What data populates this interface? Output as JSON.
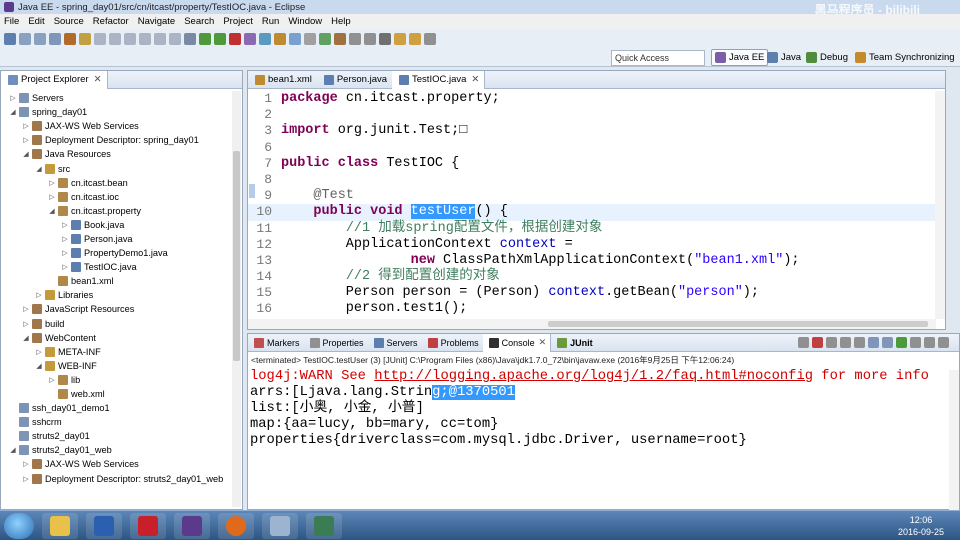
{
  "window": {
    "title": "Java EE - spring_day01/src/cn/itcast/property/TestIOC.java - Eclipse",
    "watermark": "黑马程序员 - bilibili"
  },
  "menu": [
    "File",
    "Edit",
    "Source",
    "Refactor",
    "Navigate",
    "Search",
    "Project",
    "Run",
    "Window",
    "Help"
  ],
  "toolbar": {
    "quick_access": "Quick Access",
    "perspectives": [
      "Java EE",
      "Java",
      "Debug",
      "Team Synchronizing"
    ]
  },
  "project_explorer": {
    "tab_label": "Project Explorer",
    "items": [
      {
        "label": "Servers",
        "depth": 0,
        "twisty": "▷"
      },
      {
        "label": "spring_day01",
        "depth": 0,
        "twisty": "◢"
      },
      {
        "label": "JAX-WS Web Services",
        "depth": 1,
        "twisty": "▷"
      },
      {
        "label": "Deployment Descriptor: spring_day01",
        "depth": 1,
        "twisty": "▷"
      },
      {
        "label": "Java Resources",
        "depth": 1,
        "twisty": "◢"
      },
      {
        "label": "src",
        "depth": 2,
        "twisty": "◢"
      },
      {
        "label": "cn.itcast.bean",
        "depth": 3,
        "twisty": "▷"
      },
      {
        "label": "cn.itcast.ioc",
        "depth": 3,
        "twisty": "▷"
      },
      {
        "label": "cn.itcast.property",
        "depth": 3,
        "twisty": "◢"
      },
      {
        "label": "Book.java",
        "depth": 4,
        "twisty": "▷"
      },
      {
        "label": "Person.java",
        "depth": 4,
        "twisty": "▷"
      },
      {
        "label": "PropertyDemo1.java",
        "depth": 4,
        "twisty": "▷"
      },
      {
        "label": "TestIOC.java",
        "depth": 4,
        "twisty": "▷"
      },
      {
        "label": "bean1.xml",
        "depth": 3,
        "twisty": ""
      },
      {
        "label": "Libraries",
        "depth": 2,
        "twisty": "▷"
      },
      {
        "label": "JavaScript Resources",
        "depth": 1,
        "twisty": "▷"
      },
      {
        "label": "build",
        "depth": 1,
        "twisty": "▷"
      },
      {
        "label": "WebContent",
        "depth": 1,
        "twisty": "◢"
      },
      {
        "label": "META-INF",
        "depth": 2,
        "twisty": "▷"
      },
      {
        "label": "WEB-INF",
        "depth": 2,
        "twisty": "◢"
      },
      {
        "label": "lib",
        "depth": 3,
        "twisty": "▷"
      },
      {
        "label": "web.xml",
        "depth": 3,
        "twisty": ""
      },
      {
        "label": "ssh_day01_demo1",
        "depth": 0,
        "twisty": ""
      },
      {
        "label": "sshcrm",
        "depth": 0,
        "twisty": ""
      },
      {
        "label": "struts2_day01",
        "depth": 0,
        "twisty": ""
      },
      {
        "label": "struts2_day01_web",
        "depth": 0,
        "twisty": "◢"
      },
      {
        "label": "JAX-WS Web Services",
        "depth": 1,
        "twisty": "▷"
      },
      {
        "label": "Deployment Descriptor: struts2_day01_web",
        "depth": 1,
        "twisty": "▷"
      }
    ]
  },
  "editor": {
    "tabs": [
      "bean1.xml",
      "Person.java",
      "TestIOC.java"
    ],
    "active_tab": "TestIOC.java",
    "lines": [
      {
        "n": "1",
        "html": "<span class=\"kw\">package</span> cn.itcast.property;"
      },
      {
        "n": "2",
        "html": ""
      },
      {
        "n": "3",
        "html": "<span class=\"kw\">import</span> org.junit.Test;&#9633;"
      },
      {
        "n": "6",
        "html": ""
      },
      {
        "n": "7",
        "html": "<span class=\"kw\">public class</span> TestIOC {"
      },
      {
        "n": "8",
        "html": ""
      },
      {
        "n": "9",
        "html": "    <span class=\"an\">@Test</span>"
      },
      {
        "n": "10",
        "html": "    <span class=\"kw\">public void</span> <span class=\"sel\">testUser</span>() {"
      },
      {
        "n": "11",
        "html": "        <span class=\"cm\">//1 加载spring配置文件，根据创建对象</span>"
      },
      {
        "n": "12",
        "html": "        ApplicationContext <span class=\"fv\">context</span> ="
      },
      {
        "n": "13",
        "html": "                <span class=\"kw\">new</span> ClassPathXmlApplicationContext(<span class=\"str\">\"bean1.xml\"</span>);"
      },
      {
        "n": "14",
        "html": "        <span class=\"cm\">//2 得到配置创建的对象</span>"
      },
      {
        "n": "15",
        "html": "        Person person = (Person) <span class=\"fv\">context</span>.getBean(<span class=\"str\">\"person\"</span>);"
      },
      {
        "n": "16",
        "html": "        person.test1();"
      }
    ]
  },
  "console": {
    "tabs": [
      "Markers",
      "Properties",
      "Servers",
      "Problems",
      "Console",
      "JUnit"
    ],
    "active_tab": "Console",
    "terminated": "<terminated> TestIOC.testUser (3) [JUnit] C:\\Program Files (x86)\\Java\\jdk1.7.0_72\\bin\\javaw.exe (2016年9月25日 下午12:06:24)",
    "output": [
      {
        "cls": "red",
        "html": "log4j:WARN See <span class=\"link\">http://logging.apache.org/log4j/1.2/faq.html#noconfig</span> for more info"
      },
      {
        "cls": "",
        "html": "arrs:[Ljava.lang.Strin<span class=\"sel\">g;@1370501</span>"
      },
      {
        "cls": "",
        "html": "list:[小奥, 小金, 小普]"
      },
      {
        "cls": "",
        "html": "map:{aa=lucy, bb=mary, cc=tom}"
      },
      {
        "cls": "",
        "html": "properties{driverclass=com.mysql.jdbc.Driver, username=root}"
      }
    ]
  },
  "taskbar": {
    "time": "12:06",
    "date": "2016-09-25"
  }
}
